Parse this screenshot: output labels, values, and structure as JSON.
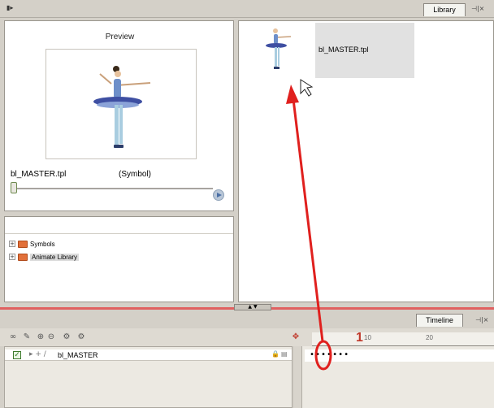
{
  "top_bar": {
    "icon": "panel-menu-icon"
  },
  "library_tab": {
    "label": "Library"
  },
  "timeline_tab": {
    "label": "Timeline"
  },
  "preview": {
    "title": "Preview",
    "symbol_name": "bl_MASTER.tpl",
    "symbol_type": "(Symbol)"
  },
  "tree": {
    "items": [
      {
        "label": "Symbols"
      },
      {
        "label": "Animate Library"
      }
    ]
  },
  "library": {
    "item_label": "bl_MASTER.tpl"
  },
  "timeline": {
    "layer_name": "bl_MASTER",
    "ruler_labels": [
      "10",
      "20"
    ],
    "current_frame": "1"
  },
  "annotation": {
    "arrow_color": "#e0201e"
  }
}
